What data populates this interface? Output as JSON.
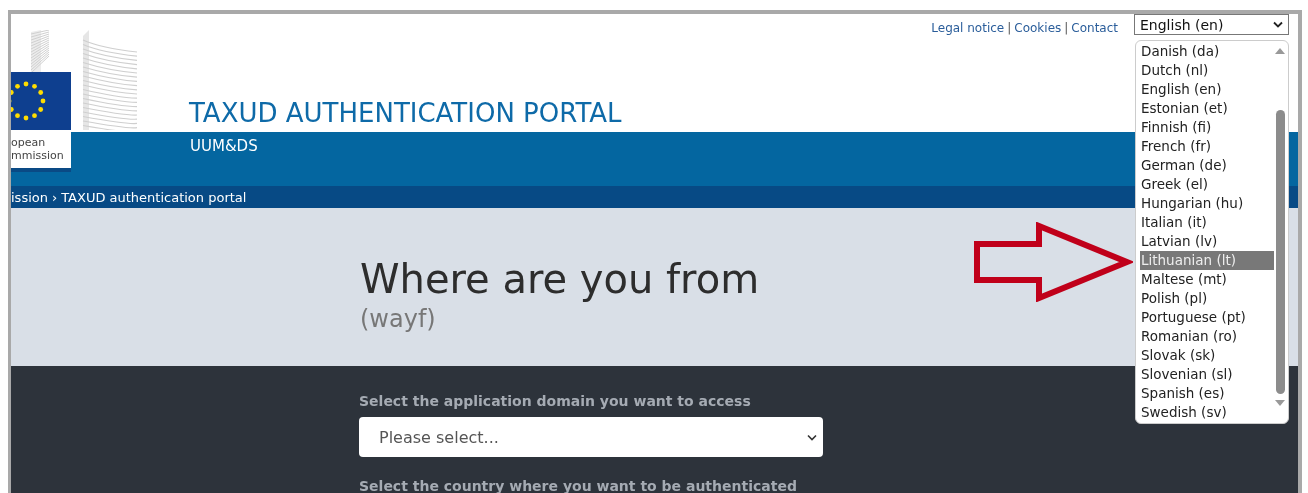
{
  "header": {
    "links": [
      "Legal notice",
      "Cookies",
      "Contact"
    ],
    "link_separator": "|",
    "logo_caption": [
      "opean",
      "mmission"
    ],
    "title": "TAXUD AUTHENTICATION PORTAL",
    "subtitle": "UUM&DS"
  },
  "language_select": {
    "value": "English (en)",
    "expanded": true,
    "options": [
      {
        "label": "Danish (da)",
        "highlighted": false
      },
      {
        "label": "Dutch (nl)",
        "highlighted": false
      },
      {
        "label": "English (en)",
        "highlighted": false
      },
      {
        "label": "Estonian (et)",
        "highlighted": false
      },
      {
        "label": "Finnish (fi)",
        "highlighted": false
      },
      {
        "label": "French (fr)",
        "highlighted": false
      },
      {
        "label": "German (de)",
        "highlighted": false
      },
      {
        "label": "Greek (el)",
        "highlighted": false
      },
      {
        "label": "Hungarian (hu)",
        "highlighted": false
      },
      {
        "label": "Italian (it)",
        "highlighted": false
      },
      {
        "label": "Latvian (lv)",
        "highlighted": false
      },
      {
        "label": "Lithuanian (lt)",
        "highlighted": true
      },
      {
        "label": "Maltese (mt)",
        "highlighted": false
      },
      {
        "label": "Polish (pl)",
        "highlighted": false
      },
      {
        "label": "Portuguese (pt)",
        "highlighted": false
      },
      {
        "label": "Romanian (ro)",
        "highlighted": false
      },
      {
        "label": "Slovak (sk)",
        "highlighted": false
      },
      {
        "label": "Slovenian (sl)",
        "highlighted": false
      },
      {
        "label": "Spanish (es)",
        "highlighted": false
      },
      {
        "label": "Swedish (sv)",
        "highlighted": false
      }
    ]
  },
  "breadcrumb": {
    "items": [
      "ission",
      "TAXUD authentication portal"
    ],
    "separator": "›"
  },
  "hero": {
    "title": "Where are you from",
    "subtitle": "(wayf)"
  },
  "form": {
    "fields": [
      {
        "label": "Select the application domain you want to access",
        "value": "Please select..."
      },
      {
        "label": "Select the country where you want to be authenticated"
      }
    ]
  }
}
